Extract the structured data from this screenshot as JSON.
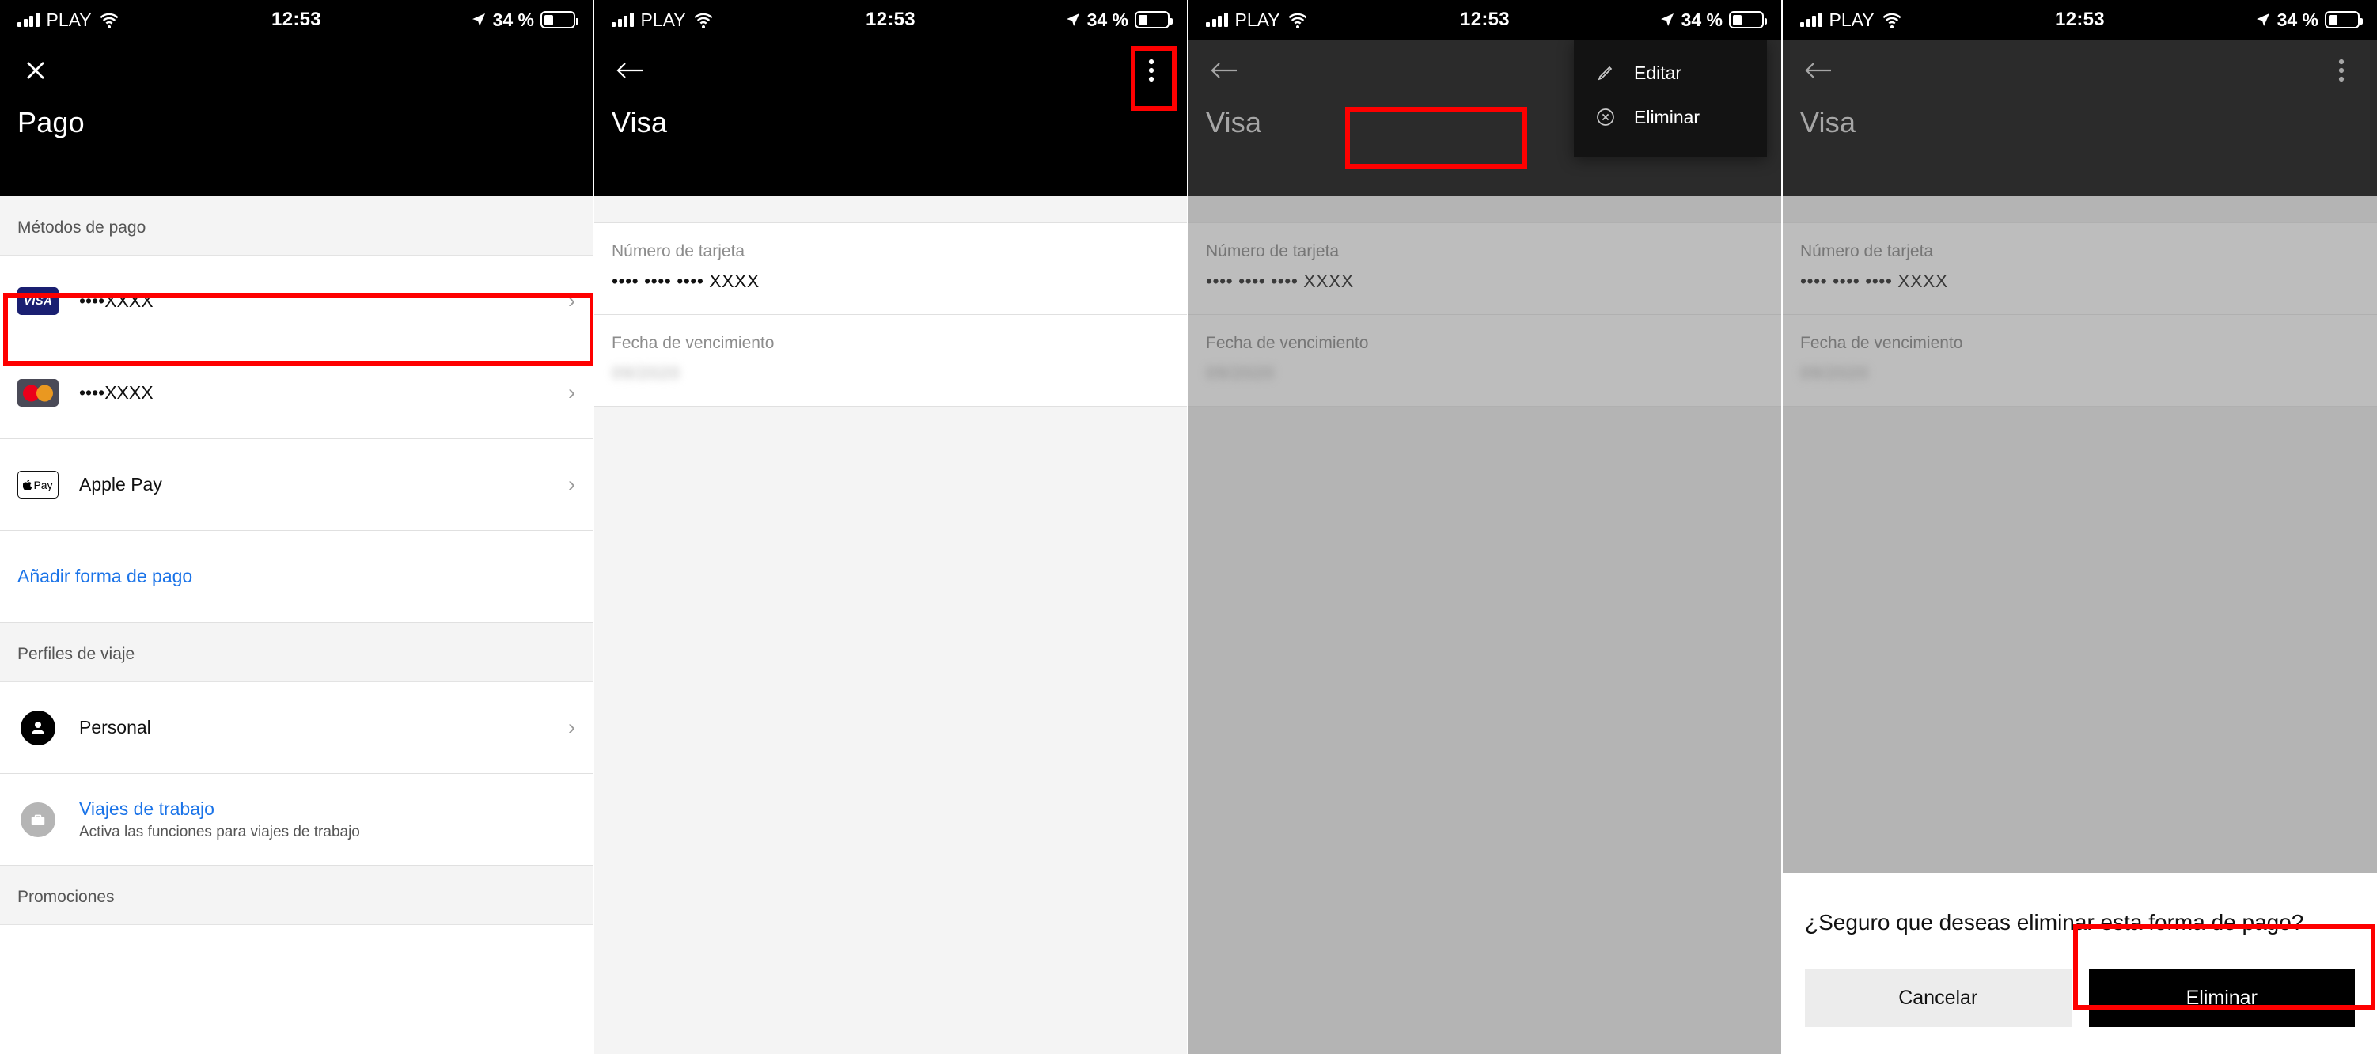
{
  "status_bar": {
    "carrier": "PLAY",
    "time": "12:53",
    "battery": "34 %",
    "signal_icon": "cellular-signal-icon",
    "wifi_icon": "wifi-icon",
    "location_icon": "location-arrow-icon",
    "battery_icon": "battery-icon"
  },
  "panel1": {
    "close_icon": "close-icon",
    "title": "Pago",
    "sections": [
      {
        "heading": "Métodos de pago"
      },
      {
        "heading": "Perfiles de viaje"
      },
      {
        "heading": "Promociones"
      }
    ],
    "payment_methods": [
      {
        "brand": "VISA",
        "icon": "visa-card-icon",
        "label": "••••XXXX",
        "chevron": "›"
      },
      {
        "brand": "Mastercard",
        "icon": "mastercard-card-icon",
        "label": "••••XXXX",
        "chevron": "›"
      },
      {
        "brand": "Apple Pay",
        "icon": "apple-pay-icon",
        "label": "Apple Pay",
        "chevron": "›"
      }
    ],
    "add_payment_label": "Añadir forma de pago",
    "travel_profiles": [
      {
        "icon": "person-avatar-icon",
        "label": "Personal",
        "sub": "",
        "chevron": "›"
      },
      {
        "icon": "briefcase-avatar-icon",
        "label": "Viajes de trabajo",
        "sub": "Activa las funciones para viajes de trabajo",
        "chevron": ""
      }
    ],
    "apple_pay_mark": "Pay"
  },
  "panel2": {
    "back_icon": "back-arrow-icon",
    "overflow_icon": "more-vertical-icon",
    "title": "Visa",
    "fields": [
      {
        "label": "Número de tarjeta",
        "value": "•••• •••• •••• XXXX",
        "blurred": false
      },
      {
        "label": "Fecha de vencimiento",
        "value": "09/2020",
        "blurred": true
      }
    ]
  },
  "panel3": {
    "back_icon": "back-arrow-icon",
    "title": "Visa",
    "fields": [
      {
        "label": "Número de tarjeta",
        "value": "•••• •••• •••• XXXX",
        "blurred": false
      },
      {
        "label": "Fecha de vencimiento",
        "value": "09/2020",
        "blurred": true
      }
    ],
    "menu": [
      {
        "icon": "pencil-edit-icon",
        "label": "Editar"
      },
      {
        "icon": "delete-circle-icon",
        "label": "Eliminar"
      }
    ]
  },
  "panel4": {
    "back_icon": "back-arrow-icon",
    "overflow_icon": "more-vertical-icon",
    "title": "Visa",
    "fields": [
      {
        "label": "Número de tarjeta",
        "value": "•••• •••• •••• XXXX",
        "blurred": false
      },
      {
        "label": "Fecha de vencimiento",
        "value": "09/2020",
        "blurred": true
      }
    ],
    "dialog": {
      "message": "¿Seguro que deseas eliminar esta forma de pago?",
      "cancel_label": "Cancelar",
      "confirm_label": "Eliminar"
    }
  },
  "annotation_color": "#fe0000"
}
